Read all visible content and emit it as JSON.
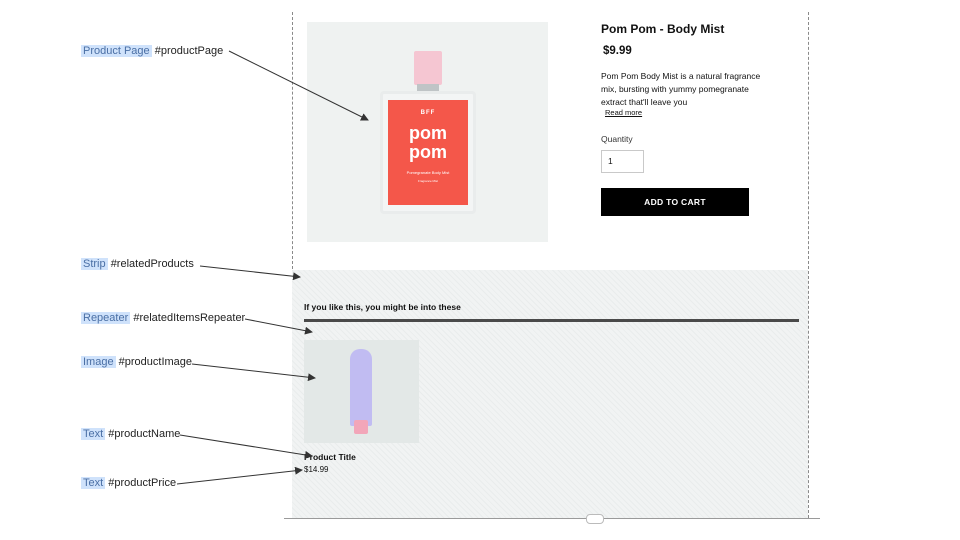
{
  "annotations": [
    {
      "tag": "Product Page",
      "id": "#productPage"
    },
    {
      "tag": "Strip",
      "id": "#relatedProducts"
    },
    {
      "tag": "Repeater",
      "id": "#relatedItemsRepeater"
    },
    {
      "tag": "Image",
      "id": "#productImage"
    },
    {
      "tag": "Text",
      "id": "#productName"
    },
    {
      "tag": "Text",
      "id": "#productPrice"
    }
  ],
  "product": {
    "image_label": {
      "brand": "BFF",
      "name_line1": "pom",
      "name_line2": "pom",
      "sub": "Pomegranate Body Mist",
      "tiny": "Fragrance Mist"
    },
    "title": "Pom Pom - Body Mist",
    "price": "$9.99",
    "description": "Pom Pom Body Mist is a natural fragrance mix, bursting with yummy pomegranate extract that'll leave you",
    "read_more": "Read more",
    "quantity_label": "Quantity",
    "quantity_value": "1",
    "add_to_cart": "ADD TO CART"
  },
  "related": {
    "heading": "If you like this, you might be into these",
    "items": [
      {
        "name": "Product Title",
        "price": "$14.99"
      }
    ]
  }
}
